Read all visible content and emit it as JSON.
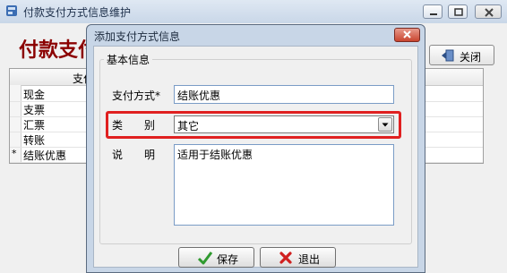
{
  "main_window": {
    "title": "付款支付方式信息维护",
    "header_title": "付款支付方式信息维护",
    "close_button_label": "关闭",
    "grid": {
      "column_header": "支付方式",
      "rows": [
        {
          "indicator": "",
          "name": "现金"
        },
        {
          "indicator": "",
          "name": "支票"
        },
        {
          "indicator": "",
          "name": "汇票"
        },
        {
          "indicator": "",
          "name": "转账"
        },
        {
          "indicator": "*",
          "name": "结账优惠"
        }
      ]
    }
  },
  "dialog": {
    "title": "添加支付方式信息",
    "group_label": "基本信息",
    "payment_method_label": "支付方式*",
    "payment_method_value": "结账优惠",
    "category_label": "类　　别",
    "category_value": "其它",
    "description_label": "说　　明",
    "description_value": "适用于结账优惠",
    "save_label": "保存",
    "exit_label": "退出"
  },
  "colors": {
    "header_title": "#8b0000",
    "highlight": "#e02020",
    "dialog_frame": "#c8d6e7"
  }
}
